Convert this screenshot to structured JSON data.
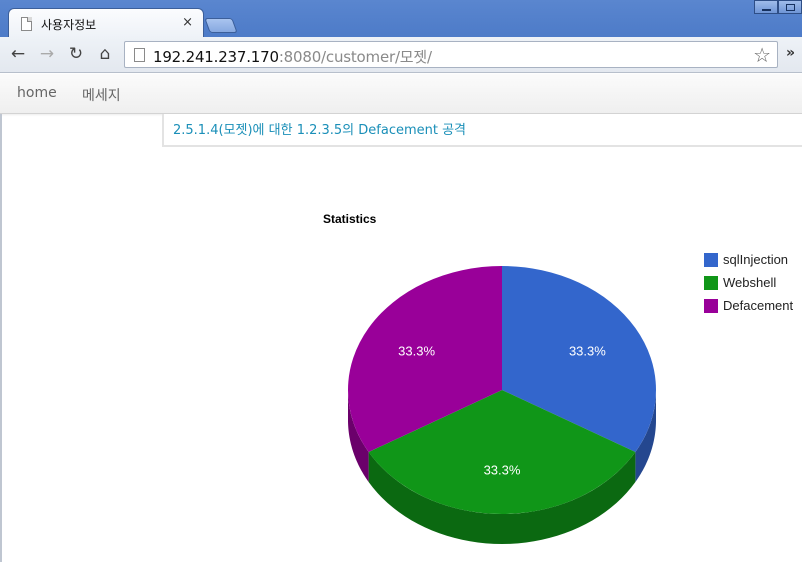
{
  "browser": {
    "tab_title": "사용자정보",
    "tab_close": "×",
    "url_host": "192.241.237.170",
    "url_rest": ":8080/customer/모젯/",
    "overflow_chevron": "»"
  },
  "nav": {
    "items": [
      {
        "label": "home"
      },
      {
        "label": "메세지"
      }
    ]
  },
  "alert": {
    "text": "2.5.1.4(모젯)에 대한 1.2.3.5의 Defacement 공격"
  },
  "colors": {
    "sqlInjection": "#3366cc",
    "Webshell": "#109618",
    "Defacement": "#990099"
  },
  "chart_data": {
    "type": "pie",
    "title": "Statistics",
    "style": "3d",
    "labels": [
      "sqlInjection",
      "Webshell",
      "Defacement"
    ],
    "values": [
      1,
      1,
      1
    ],
    "slice_labels": [
      "33.3%",
      "33.3%",
      "33.3%"
    ],
    "colors": [
      "#3366cc",
      "#109618",
      "#990099"
    ],
    "legend_position": "right"
  }
}
